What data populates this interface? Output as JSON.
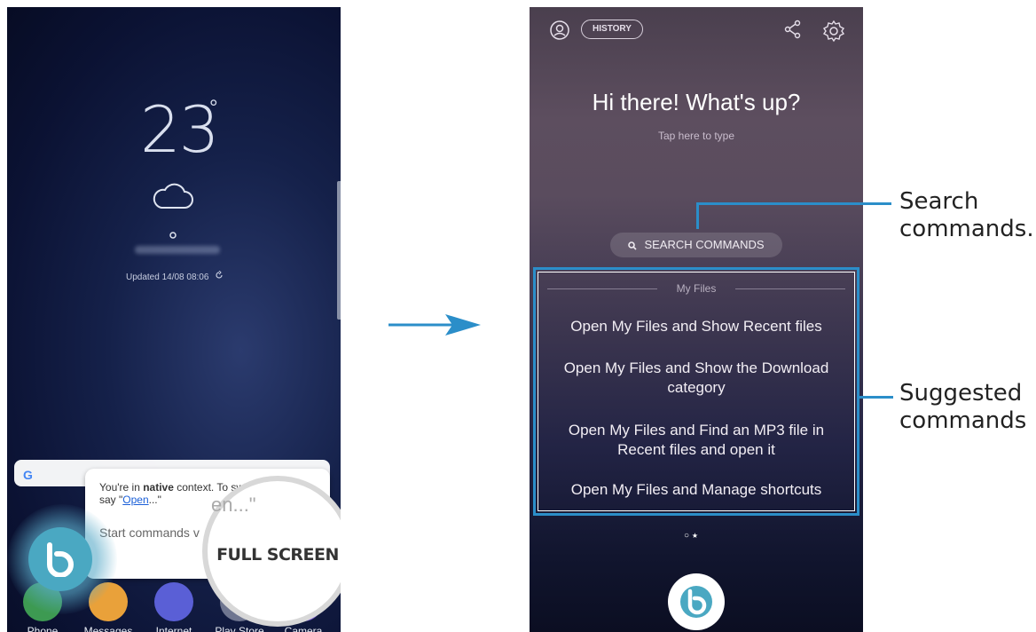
{
  "left_screen": {
    "temperature": "23",
    "degree": "°",
    "updated": "Updated 14/08 08:06",
    "google": "G",
    "dialog": {
      "context_prefix": "You're in ",
      "context_bold": "native",
      "context_mid": " context. To switch contexts,",
      "say_prefix": "say \"",
      "say_link": "Open",
      "say_suffix": "...\"",
      "listening": "en...\"",
      "start_prompt": "Start commands v"
    },
    "magnifier_label": "FULL SCREEN",
    "magnifier_listening": "en...\"",
    "dock": [
      {
        "label": "Phone",
        "color": "#3d9a52"
      },
      {
        "label": "Messages",
        "color": "#e9a13a"
      },
      {
        "label": "Internet",
        "color": "#5a5fd6"
      },
      {
        "label": "Play Store",
        "color": "#6f7690"
      },
      {
        "label": "Camera",
        "color": "#7a5bd4"
      }
    ]
  },
  "right_screen": {
    "history_label": "HISTORY",
    "greeting": "Hi there! What's up?",
    "tap_hint": "Tap here to type",
    "search_commands": "SEARCH COMMANDS",
    "section_title": "My Files",
    "commands": [
      "Open My Files and Show Recent files",
      "Open My Files and Show the Download category",
      "Open My Files and Find an MP3 file in Recent files and open it",
      "Open My Files and Manage shortcuts"
    ]
  },
  "callouts": {
    "search": "Search commands.",
    "suggested": "Suggested commands"
  },
  "colors": {
    "accent_blue": "#2b8ec9",
    "bixby_teal": "#4aa8c2"
  },
  "icons": [
    "cloud-icon",
    "location-pin-icon",
    "refresh-icon",
    "bixby-icon",
    "profile-icon",
    "share-icon",
    "gear-icon",
    "search-icon",
    "arrow-right-icon"
  ]
}
